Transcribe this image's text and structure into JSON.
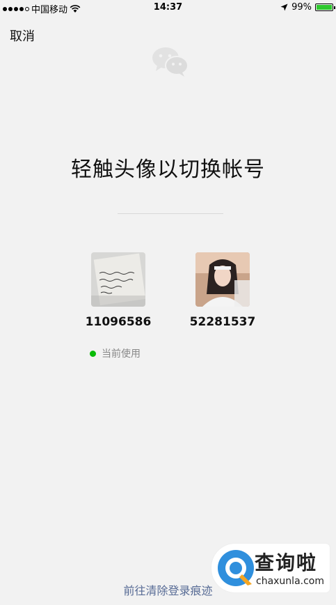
{
  "status_bar": {
    "carrier": "中国移动",
    "time": "14:37",
    "battery_percent": "99%",
    "battery_level": 0.99
  },
  "nav": {
    "cancel_label": "取消"
  },
  "main": {
    "title": "轻触头像以切换帐号",
    "accounts": [
      {
        "id": "11096586",
        "avatar": "handwritten-note-photo"
      },
      {
        "id": "52281537",
        "avatar": "girl-portrait-photo"
      }
    ],
    "current_label": "当前使用",
    "current_color": "#09bb07"
  },
  "footer": {
    "clear_link": "前往清除登录痕迹",
    "link_color": "#576b95"
  },
  "watermark": {
    "name_cn": "查询啦",
    "name_en": "chaxunla.com",
    "logo_color": "#2f8fdd",
    "accent_color": "#f5a623"
  }
}
